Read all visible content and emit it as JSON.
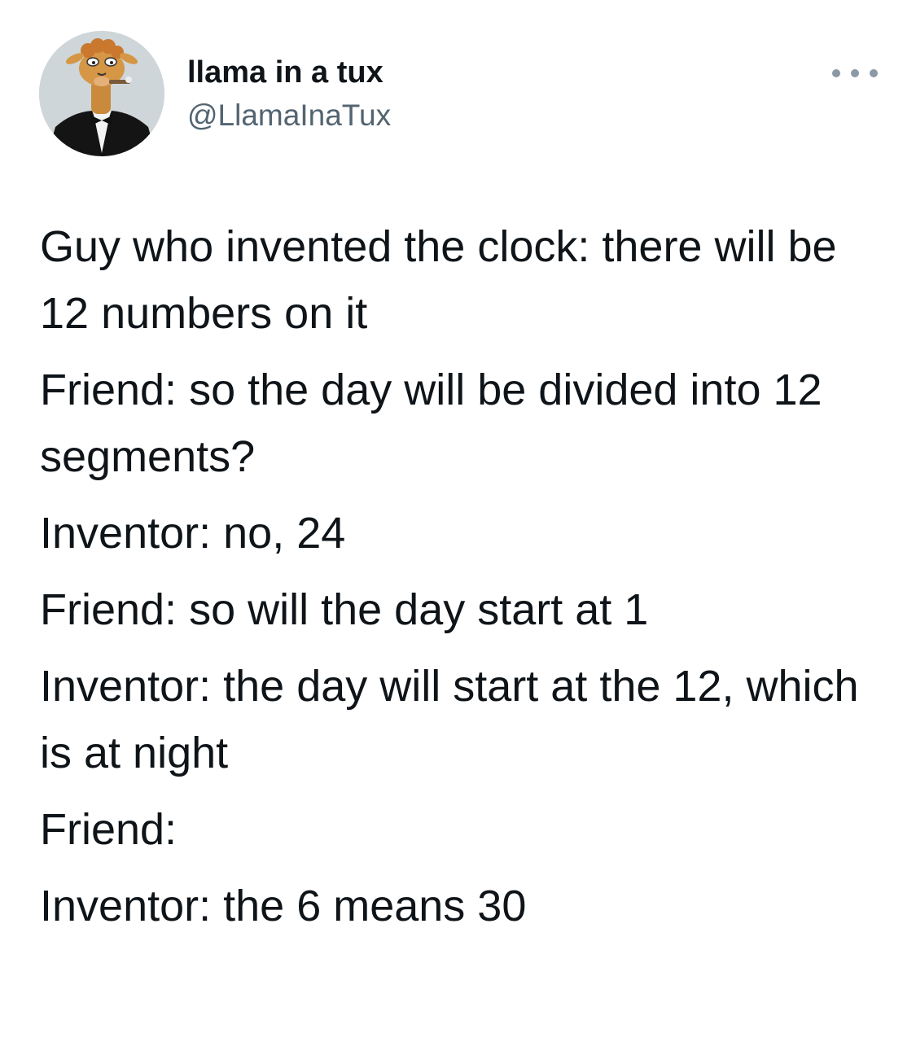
{
  "author": {
    "display_name": "llama in a tux",
    "handle": "@LlamaInaTux"
  },
  "icons": {
    "avatar": "llama-in-tuxedo-avatar",
    "more": "more-options-icon"
  },
  "colors": {
    "text": "#0f1419",
    "secondary_text": "#536471",
    "more_dots": "#8b98a5",
    "background": "#ffffff"
  },
  "tweet": {
    "paragraphs": [
      "Guy who invented the clock: there will be 12 numbers on it",
      "Friend: so the day will be divided into 12 segments?",
      "Inventor: no, 24",
      "Friend: so will the day start at 1",
      "Inventor: the day will start at the 12, which is at night",
      "Friend:",
      "Inventor: the 6 means 30"
    ]
  }
}
